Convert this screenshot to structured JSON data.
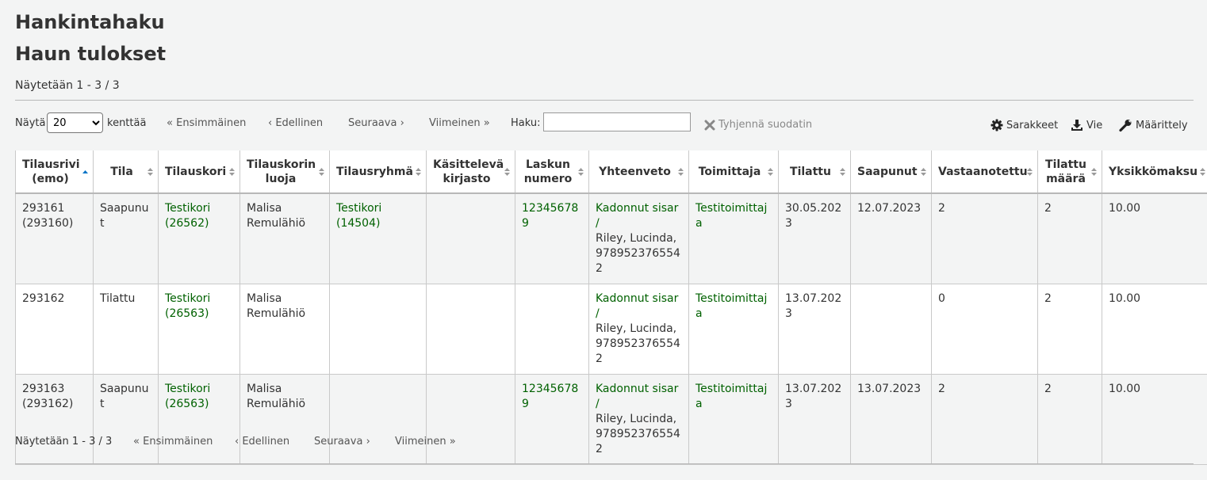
{
  "page": {
    "title": "Hankintahaku",
    "subtitle": "Haun tulokset",
    "info": "Näytetään 1 - 3 / 3"
  },
  "toolbar": {
    "show_label": "Näytä",
    "length_value": "20",
    "length_options": [
      "20"
    ],
    "entries_label": "kenttää",
    "first": "Ensimmäinen",
    "previous": "Edellinen",
    "next": "Seuraava",
    "last": "Viimeinen",
    "search_label": "Haku:",
    "search_value": "",
    "clear_filter": "Tyhjennä suodatin",
    "columns": "Sarakkeet",
    "export": "Vie",
    "configure": "Määrittely"
  },
  "columns": [
    "Tilausrivi (emo)",
    "Tila",
    "Tilauskori",
    "Tilauskorin luoja",
    "Tilausryhmä",
    "Käsittelevä kirjasto",
    "Laskun numero",
    "Yhteenveto",
    "Toimittaja",
    "Tilattu",
    "Saapunut",
    "Vastaanotettu",
    "Tilattu määrä",
    "Yksikkömaksu"
  ],
  "rows": [
    {
      "orderline": "293161 (293160)",
      "status": "Saapunut",
      "basket": "Testikori (26562)",
      "creator": "Malisa Remulähiö",
      "group": "Testikori (14504)",
      "library": "",
      "invoice": "123456789",
      "summary_title": "Kadonnut sisar /",
      "summary_rest": "Riley, Lucinda, 9789523765542",
      "vendor": "Testitoimittaja",
      "ordered": "30.05.2023",
      "arrived": "12.07.2023",
      "received": "2",
      "quantity": "2",
      "unitprice": "10.00"
    },
    {
      "orderline": "293162",
      "status": "Tilattu",
      "basket": "Testikori (26563)",
      "creator": "Malisa Remulähiö",
      "group": "",
      "library": "",
      "invoice": "",
      "summary_title": "Kadonnut sisar /",
      "summary_rest": "Riley, Lucinda, 9789523765542",
      "vendor": "Testitoimittaja",
      "ordered": "13.07.2023",
      "arrived": "",
      "received": "0",
      "quantity": "2",
      "unitprice": "10.00"
    },
    {
      "orderline": "293163 (293162)",
      "status": "Saapunut",
      "basket": "Testikori (26563)",
      "creator": "Malisa Remulähiö",
      "group": "",
      "library": "",
      "invoice": "123456789",
      "summary_title": "Kadonnut sisar /",
      "summary_rest": "Riley, Lucinda, 9789523765542",
      "vendor": "Testitoimittaja",
      "ordered": "13.07.2023",
      "arrived": "13.07.2023",
      "received": "2",
      "quantity": "2",
      "unitprice": "10.00"
    }
  ],
  "colors": {
    "link": "#006100",
    "sort_active": "#0072c6",
    "sort_idle": "#999999"
  }
}
